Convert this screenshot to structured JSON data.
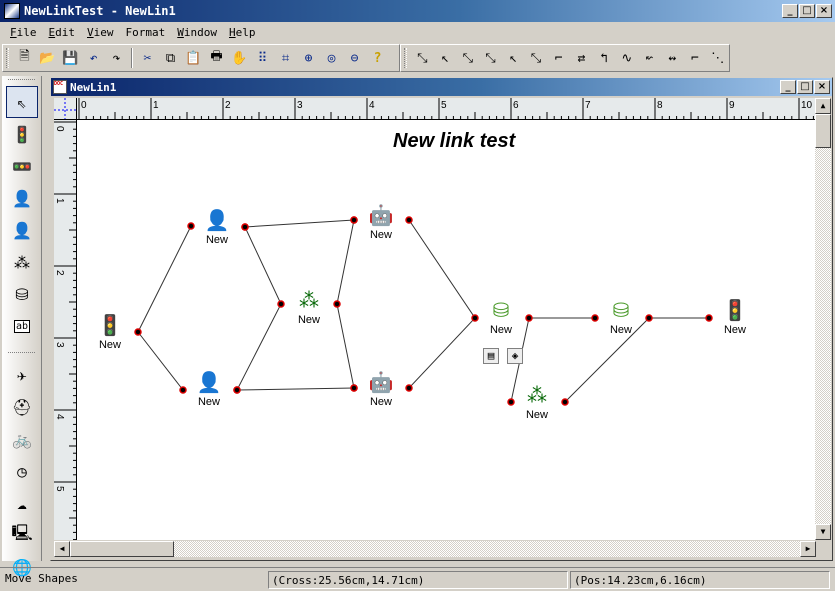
{
  "app": {
    "title": "NewLinkTest - NewLin1"
  },
  "menu": [
    {
      "key": "F",
      "rest": "ile"
    },
    {
      "key": "E",
      "rest": "dit"
    },
    {
      "key": "V",
      "rest": "iew"
    },
    {
      "key": "",
      "rest": "Format"
    },
    {
      "key": "W",
      "rest": "indow"
    },
    {
      "key": "H",
      "rest": "elp"
    }
  ],
  "toolbar_main": [
    {
      "name": "new-icon",
      "glyph": "🗎"
    },
    {
      "name": "open-icon",
      "glyph": "📂"
    },
    {
      "name": "save-icon",
      "glyph": "💾"
    },
    {
      "name": "undo-icon",
      "glyph": "↶"
    },
    {
      "name": "redo-icon",
      "glyph": "↷"
    },
    {
      "name": "cut-icon",
      "glyph": "✂"
    },
    {
      "name": "copy-icon",
      "glyph": "⧉"
    },
    {
      "name": "paste-icon",
      "glyph": "📋"
    },
    {
      "name": "print-icon",
      "glyph": "🖶"
    },
    {
      "name": "pan-hand-icon",
      "glyph": "✋"
    },
    {
      "name": "grid-icon",
      "glyph": "⠿"
    },
    {
      "name": "crop-frame-icon",
      "glyph": "⌗"
    },
    {
      "name": "zoom-in-icon",
      "glyph": "⊕"
    },
    {
      "name": "zoom-actual-icon",
      "glyph": "◎"
    },
    {
      "name": "zoom-out-icon",
      "glyph": "⊖"
    },
    {
      "name": "help-icon",
      "glyph": "?"
    }
  ],
  "toolbar_links": [
    {
      "name": "link-straight-icon",
      "glyph": "⤡"
    },
    {
      "name": "link-arrow-start-icon",
      "glyph": "↖"
    },
    {
      "name": "link-arrow-both-icon",
      "glyph": "⤡"
    },
    {
      "name": "link-straight-2-icon",
      "glyph": "⤡"
    },
    {
      "name": "link-arrow-start-2-icon",
      "glyph": "↖"
    },
    {
      "name": "link-arrow-both-2-icon",
      "glyph": "⤡"
    },
    {
      "name": "link-orthogonal-icon",
      "glyph": "⌐"
    },
    {
      "name": "link-orthogonal-arrow-both-icon",
      "glyph": "⇄"
    },
    {
      "name": "link-orthogonal-arrow-start-icon",
      "glyph": "↰"
    },
    {
      "name": "link-curve-icon",
      "glyph": "∿"
    },
    {
      "name": "link-curve-arrow-start-icon",
      "glyph": "↜"
    },
    {
      "name": "link-curve-arrow-both-icon",
      "glyph": "↭"
    },
    {
      "name": "link-polyline-icon",
      "glyph": "⌐"
    },
    {
      "name": "link-point-icon",
      "glyph": "⋱"
    }
  ],
  "left_tools_top": [
    {
      "name": "pointer-icon",
      "glyph": "⇖",
      "active": true
    },
    {
      "name": "traffic-light-green-icon",
      "glyph": "🚦"
    },
    {
      "name": "traffic-light-red-icon",
      "glyph": "🚥"
    },
    {
      "name": "user-blue-icon",
      "glyph": "👤"
    },
    {
      "name": "user-red-icon",
      "glyph": "👤"
    },
    {
      "name": "network-icon",
      "glyph": "⁂"
    },
    {
      "name": "server-icon",
      "glyph": "⛁"
    },
    {
      "name": "text-box-icon",
      "glyph": "ab"
    }
  ],
  "left_tools_bottom": [
    {
      "name": "airplane-icon",
      "glyph": "✈"
    },
    {
      "name": "colorful-hat-icon",
      "glyph": "⛑"
    },
    {
      "name": "bicycle-icon",
      "glyph": "🚲"
    },
    {
      "name": "clock-icon",
      "glyph": "◷"
    },
    {
      "name": "cloud-icon",
      "glyph": "☁"
    },
    {
      "name": "computer-icon",
      "glyph": "🖳"
    },
    {
      "name": "globe-icon",
      "glyph": "🌐"
    }
  ],
  "child": {
    "title": "NewLin1"
  },
  "ruler": {
    "h_labels": [
      "0",
      "1",
      "2",
      "3",
      "4",
      "5",
      "6",
      "7",
      "8",
      "9",
      "10"
    ],
    "v_labels": [
      "0",
      "1",
      "2",
      "3",
      "4",
      "5"
    ]
  },
  "diagram": {
    "title": "New link test",
    "nodes": [
      {
        "id": "traffic1",
        "type": "traffic-light-icon",
        "label": "New"
      },
      {
        "id": "user1",
        "type": "user-icon",
        "label": "New"
      },
      {
        "id": "user2",
        "type": "user-icon",
        "label": "New"
      },
      {
        "id": "net1",
        "type": "network-icon",
        "label": "New"
      },
      {
        "id": "robot1",
        "type": "robot-icon",
        "label": "New"
      },
      {
        "id": "robot2",
        "type": "robot-icon",
        "label": "New"
      },
      {
        "id": "server1",
        "type": "server-icon",
        "label": "New"
      },
      {
        "id": "server2",
        "type": "server-icon",
        "label": "New"
      },
      {
        "id": "traffic2",
        "type": "traffic-light-icon",
        "label": "New"
      },
      {
        "id": "net2",
        "type": "network-icon",
        "label": "New"
      }
    ]
  },
  "status": {
    "mode": "Move Shapes",
    "cross": "(Cross:25.56cm,14.71cm)",
    "pos": "(Pos:14.23cm,6.16cm)"
  }
}
